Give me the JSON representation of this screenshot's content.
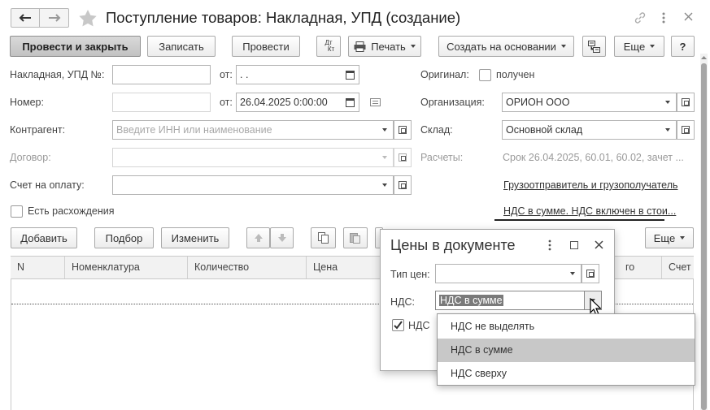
{
  "window": {
    "title": "Поступление товаров: Накладная, УПД (создание)"
  },
  "toolbar": {
    "post_close": "Провести и закрыть",
    "save": "Записать",
    "post": "Провести",
    "dtkt_top": "Дт",
    "dtkt_bottom": "Кт",
    "print": "Печать",
    "create_based": "Создать на основании",
    "more": "Еще",
    "help": "?"
  },
  "form": {
    "invoice_label": "Накладная, УПД №:",
    "invoice_value": "",
    "from1_label": "от:",
    "date1_value": " .  .",
    "number_label": "Номер:",
    "number_value": "",
    "from2_label": "от:",
    "date2_value": "26.04.2025  0:00:00",
    "counterparty_label": "Контрагент:",
    "counterparty_placeholder": "Введите ИНН или наименование",
    "contract_label": "Договор:",
    "contract_value": "",
    "payment_account_label": "Счет на оплату:",
    "payment_account_value": "",
    "discrepancies_label": "Есть расхождения",
    "original_label": "Оригинал:",
    "received_label": "получен",
    "organization_label": "Организация:",
    "organization_value": "ОРИОН ООО",
    "warehouse_label": "Склад:",
    "warehouse_value": "Основной склад",
    "settlements_label": "Расчеты:",
    "settlements_value": "Срок 26.04.2025, 60.01, 60.02, зачет ...",
    "shipper_link": "Грузоотправитель и грузополучатель",
    "vat_link": "НДС в сумме. НДС включен в стои..."
  },
  "table_toolbar": {
    "add": "Добавить",
    "pick": "Подбор",
    "change": "Изменить",
    "more": "Еще"
  },
  "table": {
    "columns": [
      "N",
      "Номенклатура",
      "Количество",
      "Цена",
      "го",
      "Счет"
    ]
  },
  "modal": {
    "title": "Цены в документе",
    "price_type_label": "Тип цен:",
    "price_type_value": "",
    "vat_label": "НДС:",
    "vat_value": "НДС в сумме",
    "vat_checkbox_label": "НДС"
  },
  "vat_dropdown": {
    "options": [
      "НДС не выделять",
      "НДС в сумме",
      "НДС сверху"
    ],
    "selected": "НДС в сумме"
  }
}
